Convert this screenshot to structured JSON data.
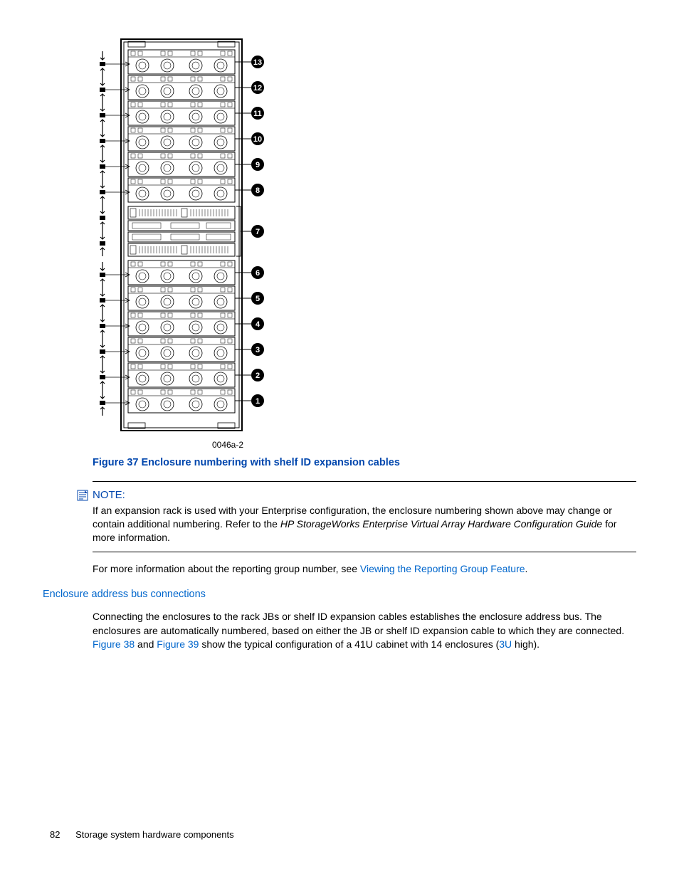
{
  "figure": {
    "ref_code": "0046a-2",
    "caption": "Figure 37 Enclosure numbering with shelf ID expansion cables",
    "callouts": [
      "13",
      "12",
      "11",
      "10",
      "9",
      "8",
      "7",
      "6",
      "5",
      "4",
      "3",
      "2",
      "1"
    ]
  },
  "note": {
    "label": "NOTE:",
    "body_1": "If an expansion rack is used with your Enterprise configuration, the enclosure numbering shown above may change or contain additional numbering. Refer to the ",
    "body_italic": "HP StorageWorks Enterprise Virtual Array Hardware Configuration Guide",
    "body_2": " for more information."
  },
  "para1": {
    "t1": "For more information about the reporting group number, see ",
    "link1": "Viewing the Reporting Group Feature",
    "t2": "."
  },
  "section": {
    "heading": "Enclosure address bus connections",
    "p_t1": "Connecting the enclosures to the rack JBs or shelf ID expansion cables establishes the enclosure address bus. The enclosures are automatically numbered, based on either the JB or shelf ID expansion cable to which they are connected. ",
    "p_link1": "Figure 38",
    "p_t2": " and ",
    "p_link2": "Figure 39",
    "p_t3": " show the typical configuration of a 41U cabinet with 14 enclosures (",
    "p_link3": "3U",
    "p_t4": " high)."
  },
  "footer": {
    "page": "82",
    "title": "Storage system hardware components"
  }
}
